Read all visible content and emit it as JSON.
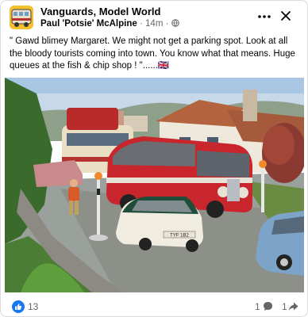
{
  "post": {
    "group_name": "Vanguards, Model World",
    "author": "Paul 'Potsie' McAlpine",
    "separator": "·",
    "time": "14m",
    "dot": "·",
    "caption": "\" Gawd blimey Margaret. We might not get a parking spot. Look at all the bloody tourists coming into town. You know what that means. Huge queues at the fish & chip shop ! \"......🇬🇧",
    "bus_plate": "",
    "car_plate": "TYF 1B2"
  },
  "reactions": {
    "like_count": "13",
    "comment_count": "1",
    "share_count": "1"
  },
  "colors": {
    "like_blue": "#1877f2",
    "secondary_text": "#65676b",
    "bus_red": "#c8262c"
  }
}
